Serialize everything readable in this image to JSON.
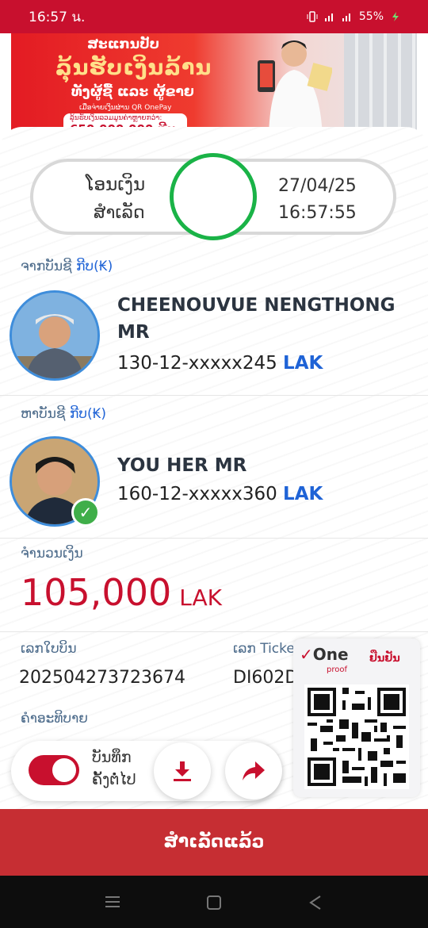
{
  "status_bar": {
    "time": "16:57 น.",
    "battery": "55%"
  },
  "banner": {
    "line1": "ສະແກນປັບ",
    "line2": "ລຸ້ນຮັບເງິນລ້ານ",
    "line3": "ທັງຜູ້ຊື້ ແລະ ຜູ້ຂາຍ",
    "line4": "ເມື່ອຈ່າຍເງິນຜ່ານ QR OnePay",
    "line5": "ລຸ້ນຮັບເງິນລວມມູນຄ່າຫຼາຍກວ່າ:",
    "prize": "650,000,000 ກີບ"
  },
  "receipt": {
    "status_line1": "ໂອນເງິນ",
    "status_line2": "ສຳເລັດ",
    "date": "27/04/25",
    "time": "16:57:55"
  },
  "from": {
    "label": "ຈາກບັນຊີ",
    "currency_label": "ກີບ(₭)",
    "name": "CHEENOUVUE NENGTHONG MR",
    "account": "130-12-xxxxx245",
    "currency": "LAK"
  },
  "to": {
    "label": "ຫາບັນຊີ",
    "currency_label": "ກີບ(₭)",
    "name": "YOU HER MR",
    "account": "160-12-xxxxx360",
    "currency": "LAK"
  },
  "amount": {
    "label": "ຈຳນວນເງິນ",
    "value": "105,000",
    "unit": "LAK"
  },
  "bill": {
    "label": "ເລກໃບບິນ",
    "value": "202504273723674"
  },
  "ticket": {
    "label": "ເລກ Ticke",
    "value": "DI602D"
  },
  "description": {
    "label": "ຄຳອະທິບາຍ"
  },
  "oneproof": {
    "logo": "One",
    "sub": "proof",
    "verify": "ຢືນຢັນ"
  },
  "actions": {
    "save_line1": "ບັນທຶກ",
    "save_line2": "ຄັ້ງຕໍ່ໄປ"
  },
  "done_button": "ສຳເລັດແລ້ວ",
  "colors": {
    "brand_red": "#c8102e",
    "success_green": "#1ab347",
    "link_blue": "#1f63d6"
  }
}
